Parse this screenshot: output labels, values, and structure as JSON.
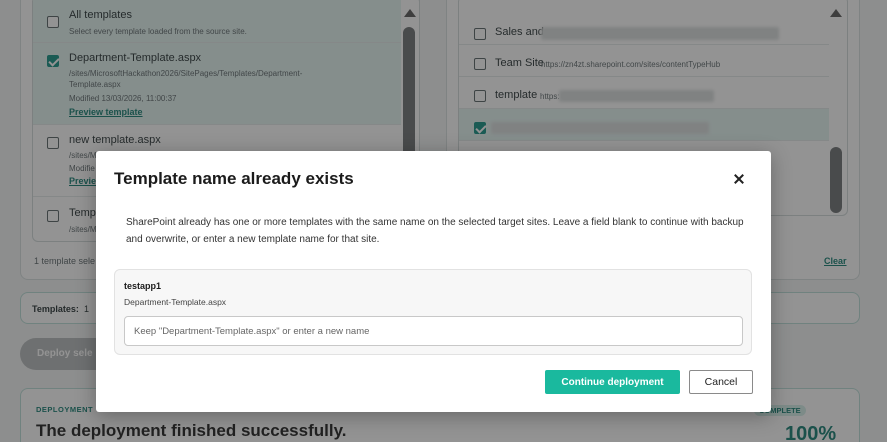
{
  "left_list": {
    "all_templates": {
      "title": "All templates",
      "subtitle": "Select every template loaded from the source site."
    },
    "items": [
      {
        "title": "Department-Template.aspx",
        "path_line1": "/sites/MicrosoftHackathon2026/SitePages/Templates/Department-",
        "path_line2": "Template.aspx",
        "modified": "Modified 13/03/2026, 11:00:37",
        "link": "Preview template",
        "checked": true
      },
      {
        "title": "new template.aspx",
        "path_line1": "/sites/M",
        "modified": "Modifie",
        "link": "Previe",
        "checked": false
      },
      {
        "title": "Temp",
        "path_line1": "/sites/M",
        "checked": false
      }
    ],
    "footer": "1 template sele"
  },
  "right_list": {
    "items": [
      {
        "name": "Sales and",
        "url": "",
        "checked": false
      },
      {
        "name": "Team Site",
        "url": "https://zn4zt.sharepoint.com/sites/contentTypeHub",
        "checked": false
      },
      {
        "name": "template",
        "url": "https:",
        "checked": false
      },
      {
        "name": "",
        "url": "",
        "checked": true
      }
    ],
    "clear_label": "Clear"
  },
  "summary": {
    "templates_label": "Templates:",
    "templates_count": "1"
  },
  "deploy_button": "Deploy sele",
  "deployment": {
    "eyebrow": "DEPLOYMENT",
    "heading": "The deployment finished successfully.",
    "badge": "COMPLETE",
    "percent": "100%"
  },
  "modal": {
    "title": "Template name already exists",
    "description": "SharePoint already has one or more templates with the same name on the selected target sites. Leave a field blank to continue with backup and overwrite, or enter a new template name for that site.",
    "site": {
      "name": "testapp1",
      "template": "Department-Template.aspx",
      "input_placeholder": "Keep \"Department-Template.aspx\" or enter a new name",
      "input_value": ""
    },
    "continue_label": "Continue deployment",
    "cancel_label": "Cancel"
  },
  "colors": {
    "accent": "#1ab99e",
    "selected_row": "#e3f4f1",
    "check": "#0f8e80"
  }
}
